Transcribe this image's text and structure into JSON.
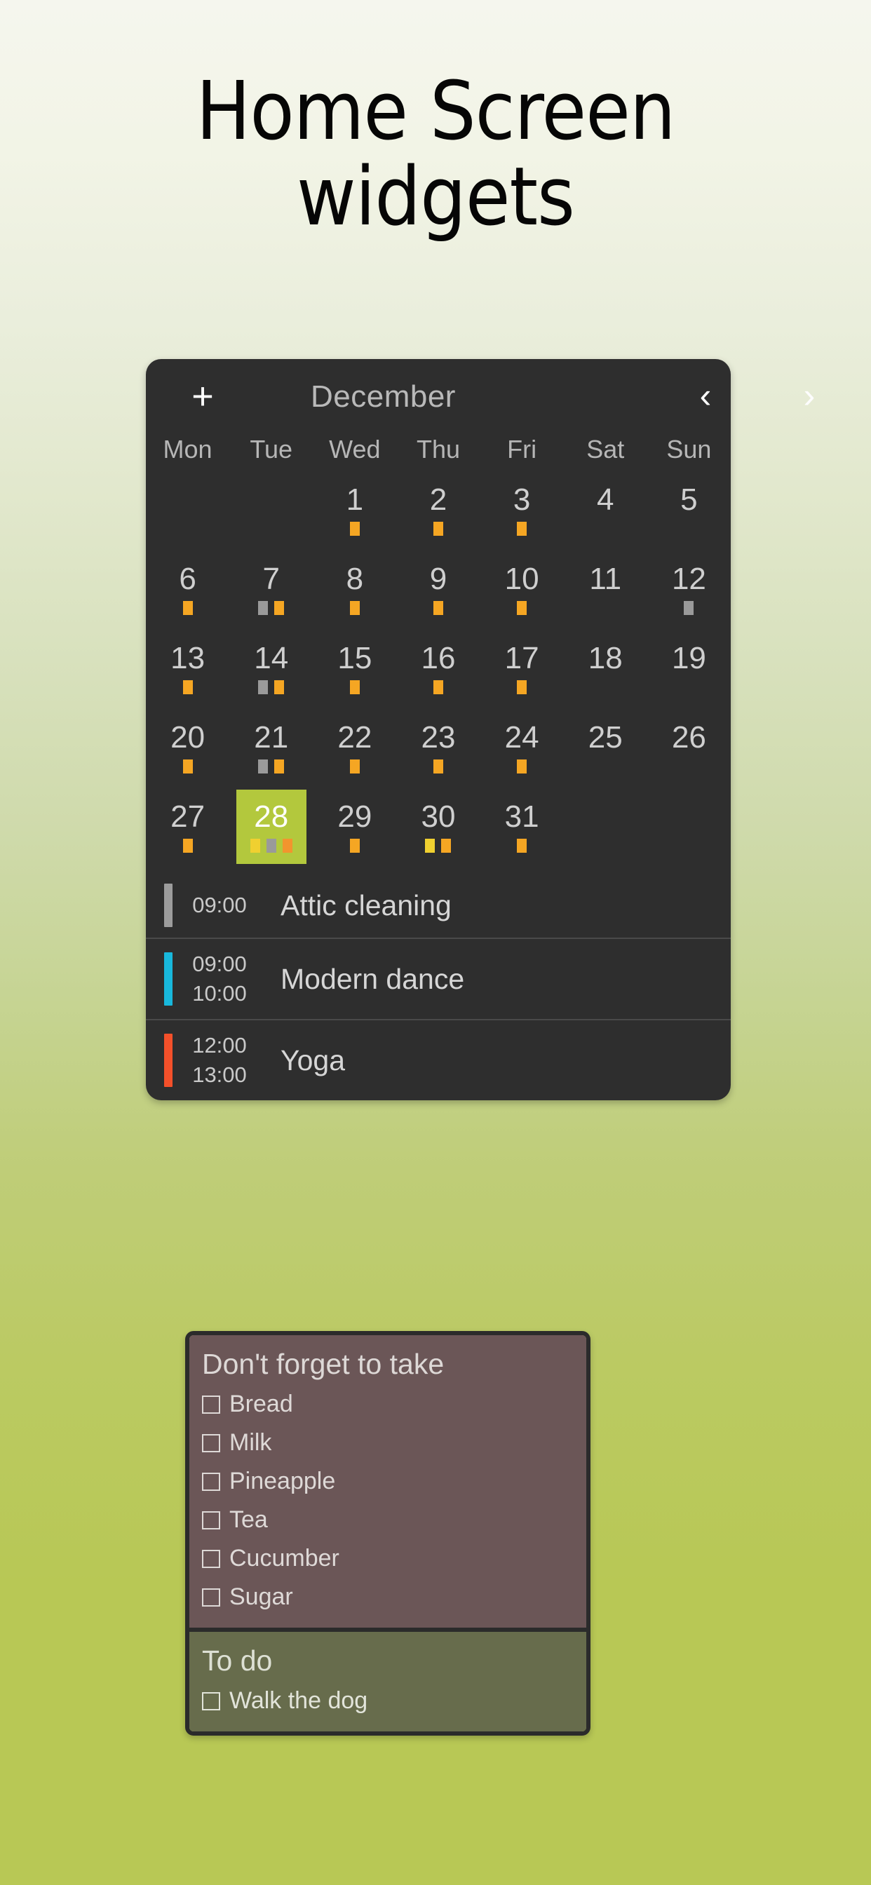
{
  "page": {
    "title_line1": "Home Screen",
    "title_line2": "widgets",
    "background_top": "#f5f6ee",
    "background_bottom": "#b8c855"
  },
  "calendar_widget": {
    "add_icon": "+",
    "month": "December",
    "prev_icon": "‹",
    "next_icon": "›",
    "weekdays": [
      "Mon",
      "Tue",
      "Wed",
      "Thu",
      "Fri",
      "Sat",
      "Sun"
    ],
    "colors": {
      "card_background": "#2e2e2e",
      "today_highlight": "#b3c83d",
      "dot_orange": "#f5a623",
      "dot_gray": "#9a9a9a",
      "dot_yellow": "#f0d030",
      "dot_orange_light": "#f2952e"
    },
    "weeks": [
      [
        {
          "label": "",
          "dots": []
        },
        {
          "label": "",
          "dots": []
        },
        {
          "label": "1",
          "dots": [
            "#f5a623"
          ]
        },
        {
          "label": "2",
          "dots": [
            "#f5a623"
          ]
        },
        {
          "label": "3",
          "dots": [
            "#f5a623"
          ]
        },
        {
          "label": "4",
          "dots": []
        },
        {
          "label": "5",
          "dots": []
        }
      ],
      [
        {
          "label": "6",
          "dots": [
            "#f5a623"
          ]
        },
        {
          "label": "7",
          "dots": [
            "#9a9a9a",
            "#f5a623"
          ]
        },
        {
          "label": "8",
          "dots": [
            "#f5a623"
          ]
        },
        {
          "label": "9",
          "dots": [
            "#f5a623"
          ]
        },
        {
          "label": "10",
          "dots": [
            "#f5a623"
          ]
        },
        {
          "label": "11",
          "dots": []
        },
        {
          "label": "12",
          "dots": [
            "#9a9a9a"
          ]
        }
      ],
      [
        {
          "label": "13",
          "dots": [
            "#f5a623"
          ]
        },
        {
          "label": "14",
          "dots": [
            "#9a9a9a",
            "#f5a623"
          ]
        },
        {
          "label": "15",
          "dots": [
            "#f5a623"
          ]
        },
        {
          "label": "16",
          "dots": [
            "#f5a623"
          ]
        },
        {
          "label": "17",
          "dots": [
            "#f5a623"
          ]
        },
        {
          "label": "18",
          "dots": []
        },
        {
          "label": "19",
          "dots": []
        }
      ],
      [
        {
          "label": "20",
          "dots": [
            "#f5a623"
          ]
        },
        {
          "label": "21",
          "dots": [
            "#9a9a9a",
            "#f5a623"
          ]
        },
        {
          "label": "22",
          "dots": [
            "#f5a623"
          ]
        },
        {
          "label": "23",
          "dots": [
            "#f5a623"
          ]
        },
        {
          "label": "24",
          "dots": [
            "#f5a623"
          ]
        },
        {
          "label": "25",
          "dots": []
        },
        {
          "label": "26",
          "dots": []
        }
      ],
      [
        {
          "label": "27",
          "dots": [
            "#f5a623"
          ]
        },
        {
          "label": "28",
          "dots": [
            "#f0d030",
            "#9a9a9a",
            "#f2952e"
          ],
          "today": true
        },
        {
          "label": "29",
          "dots": [
            "#f5a623"
          ]
        },
        {
          "label": "30",
          "dots": [
            "#f0d030",
            "#f5a623"
          ]
        },
        {
          "label": "31",
          "dots": [
            "#f5a623"
          ]
        },
        {
          "label": "",
          "dots": []
        },
        {
          "label": "",
          "dots": []
        }
      ]
    ],
    "events": [
      {
        "start": "09:00",
        "end": "",
        "title": "Attic cleaning",
        "color": "#9c9c9c"
      },
      {
        "start": "09:00",
        "end": "10:00",
        "title": "Modern dance",
        "color": "#18b8dc"
      },
      {
        "start": "12:00",
        "end": "13:00",
        "title": "Yoga",
        "color": "#f4502a"
      }
    ]
  },
  "notes_widget": {
    "shopping": {
      "heading": "Don't forget to take",
      "background": "#6b5657",
      "items": [
        "Bread",
        "Milk",
        "Pineapple",
        "Tea",
        "Cucumber",
        "Sugar"
      ]
    },
    "todo": {
      "heading": "To do",
      "background": "#676c4c",
      "items": [
        "Walk the dog"
      ]
    }
  }
}
